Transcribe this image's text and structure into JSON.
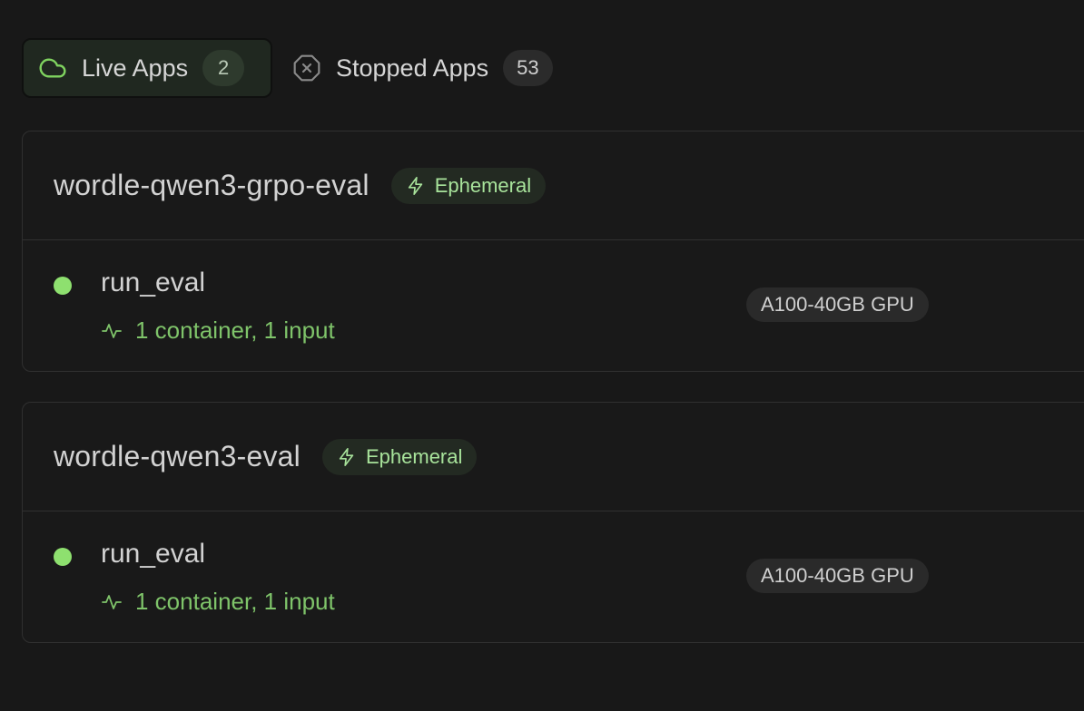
{
  "tabs": {
    "live": {
      "label": "Live Apps",
      "count": "2",
      "icon": "cloud-icon",
      "active": true
    },
    "stopped": {
      "label": "Stopped Apps",
      "count": "53",
      "icon": "x-circle-icon",
      "active": false
    }
  },
  "apps": [
    {
      "name": "wordle-qwen3-grpo-eval",
      "badge": "Ephemeral",
      "functions": [
        {
          "name": "run_eval",
          "stats": "1 container, 1 input",
          "gpu": "A100-40GB GPU",
          "status": "running"
        }
      ]
    },
    {
      "name": "wordle-qwen3-eval",
      "badge": "Ephemeral",
      "functions": [
        {
          "name": "run_eval",
          "stats": "1 container, 1 input",
          "gpu": "A100-40GB GPU",
          "status": "running"
        }
      ]
    }
  ],
  "colors": {
    "background": "#181818",
    "accent_green": "#8ee06f",
    "stats_green": "#7fc46a",
    "badge_text": "#a8e39b"
  }
}
